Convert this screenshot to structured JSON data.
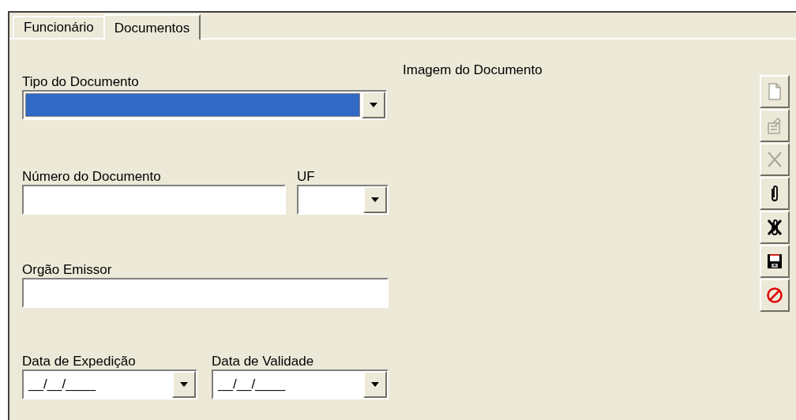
{
  "tabs": [
    {
      "label": "Funcionário",
      "selected": false
    },
    {
      "label": "Documentos",
      "selected": true
    }
  ],
  "form": {
    "document_type": {
      "label": "Tipo do Documento",
      "focused": true
    },
    "document_number": {
      "label": "Número do Documento"
    },
    "state": {
      "label": "UF"
    },
    "issuer": {
      "label": "Orgão Emissor"
    },
    "issue_date": {
      "label": "Data de Expedição",
      "value": "__/__/____"
    },
    "expiry_date": {
      "label": "Data de Validade",
      "value": "__/__/____"
    }
  },
  "image_panel": {
    "label": "Imagem do Documento"
  },
  "toolbar": [
    {
      "kind": "new",
      "disabled": true
    },
    {
      "kind": "edit",
      "disabled": true
    },
    {
      "kind": "delete",
      "disabled": true
    },
    {
      "kind": "attach",
      "disabled": false
    },
    {
      "kind": "detach",
      "disabled": false
    },
    {
      "kind": "save",
      "disabled": false
    },
    {
      "kind": "cancel",
      "disabled": false
    }
  ]
}
